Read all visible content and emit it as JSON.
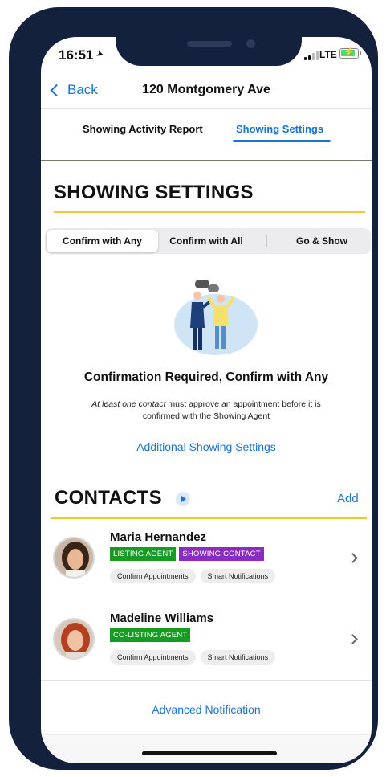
{
  "status_bar": {
    "time": "16:51",
    "network": "LTE"
  },
  "nav": {
    "back_label": "Back",
    "title": "120 Montgomery Ave"
  },
  "tabs": [
    {
      "label": "Showing Activity Report",
      "active": false
    },
    {
      "label": "Showing Settings",
      "active": true
    }
  ],
  "showing_settings": {
    "heading": "SHOWING SETTINGS",
    "segments": [
      {
        "label": "Confirm with Any",
        "selected": true
      },
      {
        "label": "Confirm with All",
        "selected": false
      },
      {
        "label": "Go & Show",
        "selected": false
      }
    ],
    "confirm_title_prefix": "Confirmation Required, Confirm with ",
    "confirm_title_emphasis": "Any",
    "desc_italic": "At least one contact",
    "desc_rest": " must approve an appointment before it is confirmed with the Showing Agent",
    "additional_link": "Additional Showing Settings"
  },
  "contacts": {
    "heading": "CONTACTS",
    "add_label": "Add",
    "items": [
      {
        "name": "Maria Hernandez",
        "roles": [
          "LISTING AGENT",
          "SHOWING CONTACT"
        ],
        "options": [
          "Confirm Appointments",
          "Smart Notifications"
        ]
      },
      {
        "name": "Madeline Williams",
        "roles": [
          "CO-LISTING AGENT"
        ],
        "options": [
          "Confirm Appointments",
          "Smart Notifications"
        ]
      }
    ],
    "advanced_link": "Advanced Notification"
  },
  "colors": {
    "accent_blue": "#1a73d9",
    "gold": "#f5c533",
    "badge_green": "#169c23",
    "badge_purple": "#8a2bc2",
    "phone_frame": "#14213d"
  }
}
